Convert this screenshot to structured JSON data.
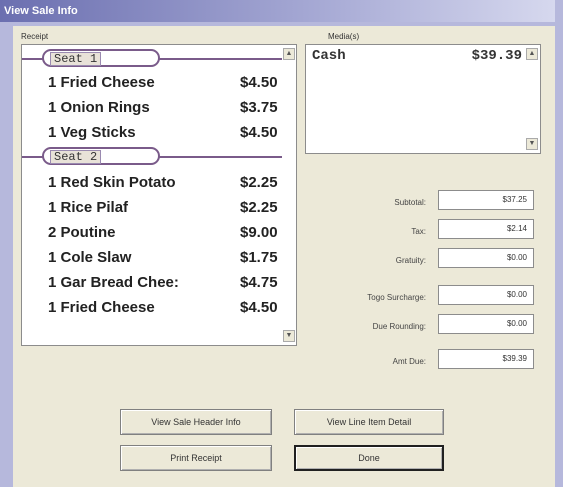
{
  "window": {
    "title": "View Sale Info"
  },
  "receipt": {
    "label": "Receipt",
    "seats": [
      {
        "label": "Seat 1",
        "items": [
          {
            "name": "1 Fried Cheese",
            "price": "$4.50"
          },
          {
            "name": "1 Onion Rings",
            "price": "$3.75"
          },
          {
            "name": "1 Veg Sticks",
            "price": "$4.50"
          }
        ]
      },
      {
        "label": "Seat 2",
        "items": [
          {
            "name": "1 Red Skin Potato",
            "price": "$2.25"
          },
          {
            "name": "1 Rice Pilaf",
            "price": "$2.25"
          },
          {
            "name": "2 Poutine",
            "price": "$9.00"
          },
          {
            "name": "1 Cole Slaw",
            "price": "$1.75"
          },
          {
            "name": "1 Gar Bread Chee:",
            "price": "$4.75"
          },
          {
            "name": "1 Fried Cheese",
            "price": "$4.50"
          }
        ]
      }
    ]
  },
  "media": {
    "label": "Media(s)",
    "rows": [
      {
        "type": "Cash",
        "amount": "$39.39"
      }
    ]
  },
  "totals": [
    {
      "label": "Subtotal:",
      "value": "$37.25"
    },
    {
      "label": "Tax:",
      "value": "$2.14"
    },
    {
      "label": "Gratuity:",
      "value": "$0.00"
    },
    {
      "label": "Togo Surcharge:",
      "value": "$0.00"
    },
    {
      "label": "Due Rounding:",
      "value": "$0.00"
    },
    {
      "label": "Amt Due:",
      "value": "$39.39"
    }
  ],
  "buttons": {
    "header_info": "View Sale Header Info",
    "line_detail": "View Line Item Detail",
    "print": "Print Receipt",
    "done": "Done"
  }
}
